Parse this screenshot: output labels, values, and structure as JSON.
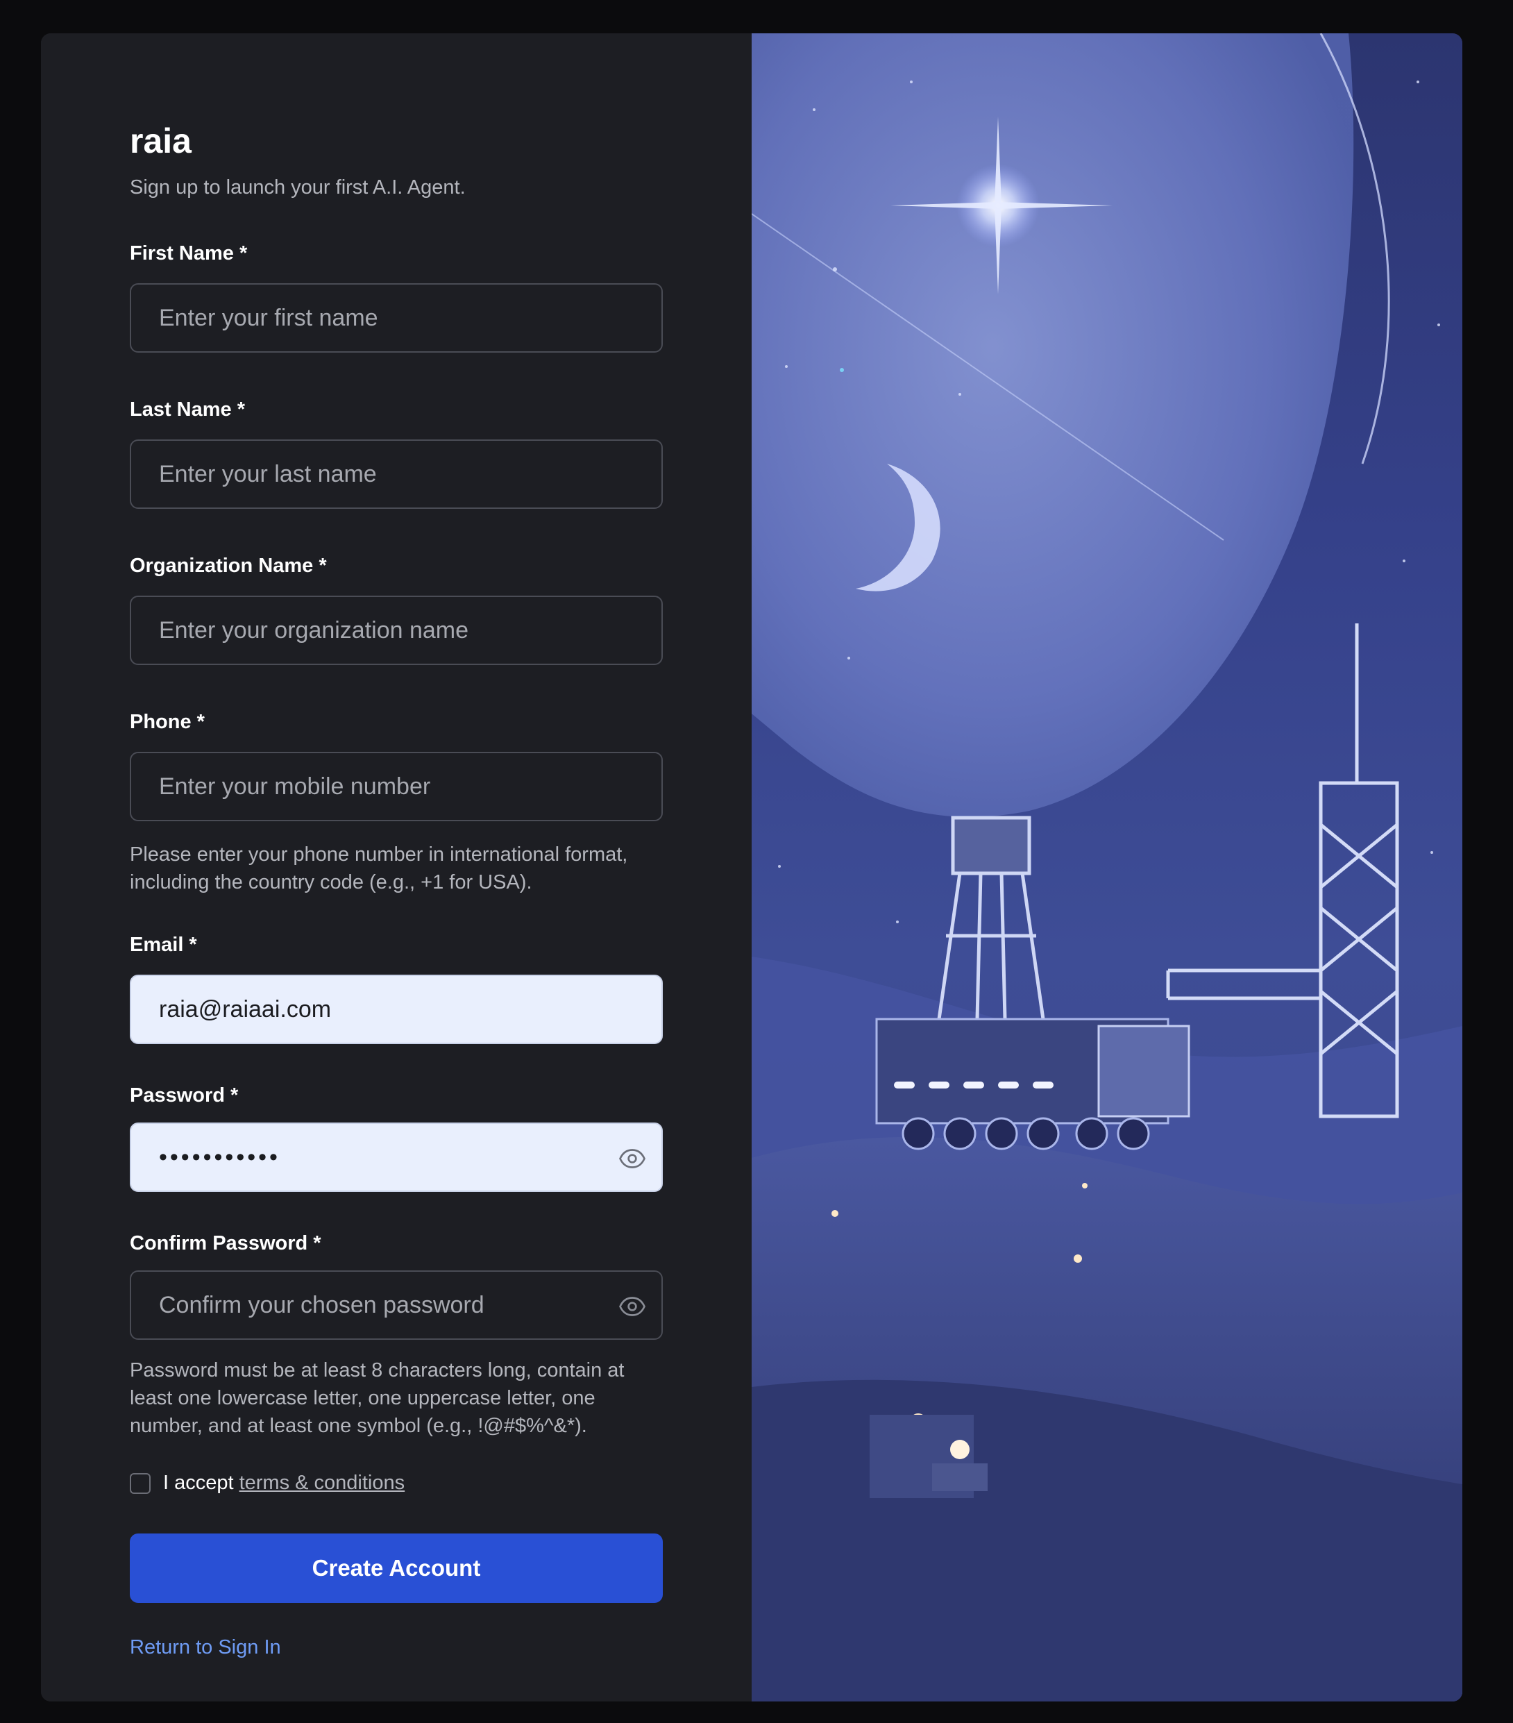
{
  "brand": "raia",
  "subtitle": "Sign up to launch your first A.I. Agent.",
  "fields": {
    "first_name": {
      "label": "First Name *",
      "placeholder": "Enter your first name",
      "value": ""
    },
    "last_name": {
      "label": "Last Name *",
      "placeholder": "Enter your last name",
      "value": ""
    },
    "organization": {
      "label": "Organization Name *",
      "placeholder": "Enter your organization name",
      "value": ""
    },
    "phone": {
      "label": "Phone *",
      "placeholder": "Enter your mobile number",
      "value": "",
      "hint": "Please enter your phone number in international format, including the country code (e.g., +1 for USA)."
    },
    "email": {
      "label": "Email *",
      "placeholder": "",
      "value": "raia@raiaai.com"
    },
    "password": {
      "label": "Password *",
      "placeholder": "",
      "value": "•••••••••••"
    },
    "confirm_password": {
      "label": "Confirm Password *",
      "placeholder": "Confirm your chosen password",
      "value": "",
      "hint": "Password must be at least 8 characters long, contain at least one lowercase letter, one uppercase letter, one number, and at least one symbol (e.g., !@#$%^&*)."
    }
  },
  "terms": {
    "prefix": "I accept",
    "link": "terms & conditions",
    "checked": false
  },
  "create_button": "Create Account",
  "return_link": "Return to Sign In",
  "colors": {
    "panel": "#1d1e23",
    "primary": "#2950d5",
    "link": "#6f9cf5",
    "filled_input": "#e9effd"
  },
  "icons": {
    "password_toggle": "eye-icon"
  }
}
